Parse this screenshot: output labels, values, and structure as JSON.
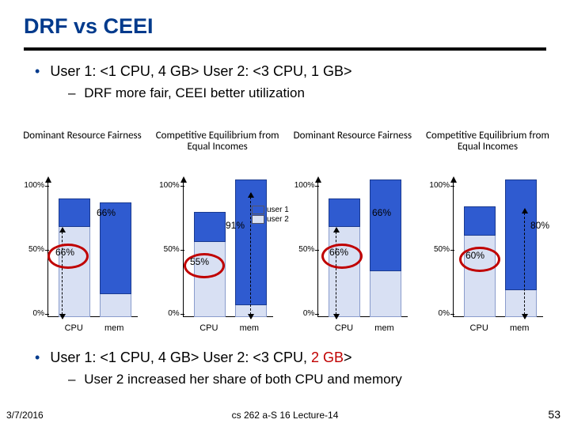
{
  "title": "DRF vs CEEI",
  "bullets": {
    "top_main": "User 1: <1 CPU, 4 GB>   User 2: <3 CPU, 1 GB>",
    "top_sub": "DRF more fair, CEEI better utilization",
    "bottom_main_pre": "User 1: <1 CPU, 4 GB>   User 2: <3 CPU, ",
    "bottom_main_red": "2 GB",
    "bottom_main_post": ">",
    "bottom_sub": "User 2 increased her share of both CPU and memory"
  },
  "legend": {
    "u1": "user 1",
    "u2": "user 2"
  },
  "axis": {
    "y100": "100%",
    "y50": "50%",
    "y0": "0%",
    "xcpu": "CPU",
    "xmem": "mem"
  },
  "panels": [
    {
      "label": "Dominant Resource Fairness"
    },
    {
      "label": "Competitive Equilibrium from Equal Incomes"
    },
    {
      "label": "Dominant Resource Fairness"
    },
    {
      "label": "Competitive Equilibrium from Equal Incomes"
    }
  ],
  "annot": {
    "p0_a": "66%",
    "p0_b": "66%",
    "p1_a": "91%",
    "p1_b": "55%",
    "p2_a": "66%",
    "p2_b": "66%",
    "p3_a": "80%",
    "p3_b": "60%"
  },
  "footer": {
    "date": "3/7/2016",
    "center": "cs 262 a-S 16 Lecture-14",
    "page": "53"
  },
  "chart_data": [
    {
      "type": "bar",
      "title": "Dominant Resource Fairness",
      "categories": [
        "CPU",
        "mem"
      ],
      "ylabel": "",
      "ylim": [
        0,
        100
      ],
      "series": [
        {
          "name": "user 1",
          "values": [
            20,
            66
          ]
        },
        {
          "name": "user 2",
          "values": [
            66,
            17
          ]
        }
      ]
    },
    {
      "type": "bar",
      "title": "Competitive Equilibrium from Equal Incomes",
      "categories": [
        "CPU",
        "mem"
      ],
      "ylabel": "",
      "ylim": [
        0,
        100
      ],
      "series": [
        {
          "name": "user 1",
          "values": [
            21,
            91
          ]
        },
        {
          "name": "user 2",
          "values": [
            55,
            9
          ]
        }
      ]
    },
    {
      "type": "bar",
      "title": "Dominant Resource Fairness",
      "categories": [
        "CPU",
        "mem"
      ],
      "ylabel": "",
      "ylim": [
        0,
        100
      ],
      "series": [
        {
          "name": "user 1",
          "values": [
            20,
            66
          ]
        },
        {
          "name": "user 2",
          "values": [
            66,
            34
          ]
        }
      ]
    },
    {
      "type": "bar",
      "title": "Competitive Equilibrium from Equal Incomes",
      "categories": [
        "CPU",
        "mem"
      ],
      "ylabel": "",
      "ylim": [
        0,
        100
      ],
      "series": [
        {
          "name": "user 1",
          "values": [
            20,
            80
          ]
        },
        {
          "name": "user 2",
          "values": [
            60,
            20
          ]
        }
      ]
    }
  ]
}
